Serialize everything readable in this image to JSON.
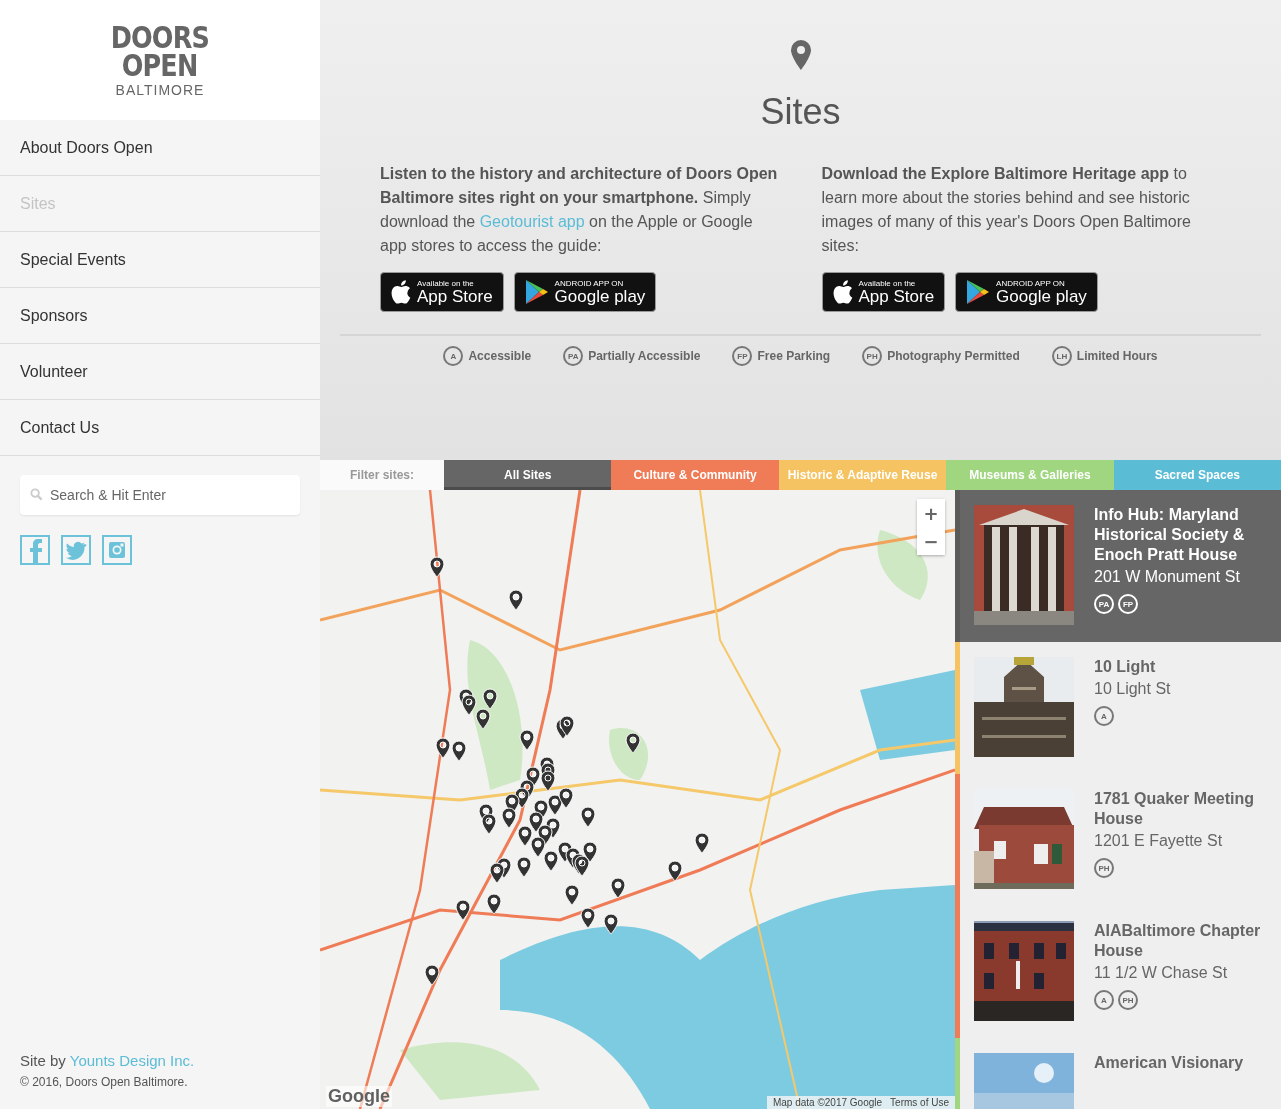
{
  "logo": {
    "line_1": "DOORS",
    "line_2": "OPEN",
    "line_3": "BALTIMORE"
  },
  "nav": [
    {
      "label": "About Doors Open",
      "selected": false
    },
    {
      "label": "Sites",
      "selected": true
    },
    {
      "label": "Special Events",
      "selected": false
    },
    {
      "label": "Sponsors",
      "selected": false
    },
    {
      "label": "Volunteer",
      "selected": false
    },
    {
      "label": "Contact Us",
      "selected": false
    }
  ],
  "search": {
    "placeholder": "Search & Hit Enter"
  },
  "social": [
    {
      "kind": "facebook"
    },
    {
      "kind": "twitter"
    },
    {
      "kind": "instagram"
    }
  ],
  "footer": {
    "credit_prefix": "Site by ",
    "credit_link": "Younts Design Inc.",
    "copyright": "© 2016, Doors Open Baltimore."
  },
  "page_title": "Sites",
  "columns": [
    {
      "before": "**Listen to the history and architecture of Doors Open Baltimore sites right on your smartphone.** Simply download the ",
      "link": "Geotourist app",
      "after": " on the Apple or Google app stores to access the guide:",
      "badges": [
        {
          "kind": "apple",
          "small": "Available on the",
          "big": "App Store"
        },
        {
          "kind": "google",
          "small": "ANDROID APP ON",
          "big": "Google play"
        }
      ]
    },
    {
      "before": "**Download the Explore Baltimore Heritage app** to learn more about the stories behind and see historic images of many of this year's Doors Open Baltimore sites:",
      "badges": [
        {
          "kind": "apple",
          "small": "Available on the",
          "big": "App Store"
        },
        {
          "kind": "google",
          "small": "ANDROID APP ON",
          "big": "Google play"
        }
      ]
    }
  ],
  "legend": [
    {
      "code": "A",
      "label": "Accessible"
    },
    {
      "code": "PA",
      "label": "Partially Accessible"
    },
    {
      "code": "FP",
      "label": "Free Parking"
    },
    {
      "code": "PH",
      "label": "Photography Permitted"
    },
    {
      "code": "LH",
      "label": "Limited Hours"
    }
  ],
  "filter": {
    "label": "Filter sites:",
    "options": [
      {
        "label": "All Sites",
        "color": "#666666",
        "selected": true
      },
      {
        "label": "Culture & Community",
        "color": "#ef7c56",
        "selected": false
      },
      {
        "label": "Historic & Adaptive Reuse",
        "color": "#f5c362",
        "selected": false
      },
      {
        "label": "Museums & Galleries",
        "color": "#9fd67f",
        "selected": false
      },
      {
        "label": "Sacred Spaces",
        "color": "#5bbcd6",
        "selected": false
      }
    ]
  },
  "map": {
    "kind": "picture",
    "zoom_in": "+",
    "zoom_out": "−",
    "logo": "Google",
    "attribution": "Map data ©2017 Google",
    "terms": "Terms of Use"
  },
  "sites": [
    {
      "name": "Info Hub: Maryland Historical Society & Enoch Pratt House",
      "address": "201 W Monument St",
      "tags": [
        "PA",
        "FP"
      ],
      "color": "#5a5a5a",
      "selected": true
    },
    {
      "name": "10 Light",
      "address": "10 Light St",
      "tags": [
        "A"
      ],
      "color": "#f5c362",
      "selected": false
    },
    {
      "name": "1781 Quaker Meeting House",
      "address": "1201 E Fayette St",
      "tags": [
        "PH"
      ],
      "color": "#ef7c56",
      "selected": false
    },
    {
      "name": "AIABaltimore Chapter House",
      "address": "11 1/2 W Chase St",
      "tags": [
        "A",
        "PH"
      ],
      "color": "#ef7c56",
      "selected": false
    },
    {
      "name": "American Visionary",
      "color": "#9fd67f",
      "selected": false
    }
  ]
}
